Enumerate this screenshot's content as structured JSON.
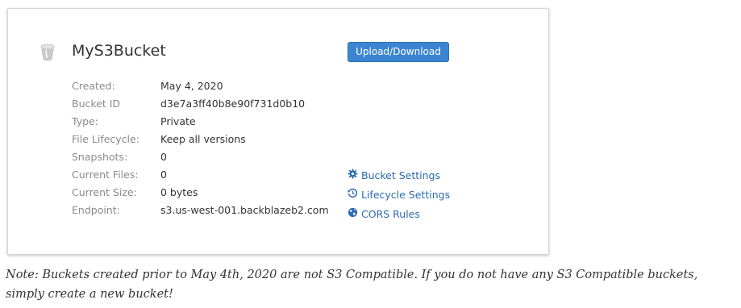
{
  "bucket": {
    "name": "MyS3Bucket",
    "upload_button_label": "Upload/Download"
  },
  "details": [
    {
      "label": "Created:",
      "value": "May 4, 2020"
    },
    {
      "label": "Bucket ID",
      "value": "d3e7a3ff40b8e90f731d0b10"
    },
    {
      "label": "Type:",
      "value": "Private"
    },
    {
      "label": "File Lifecycle:",
      "value": "Keep all versions"
    },
    {
      "label": "Snapshots:",
      "value": "0"
    },
    {
      "label": "Current Files:",
      "value": "0"
    },
    {
      "label": "Current Size:",
      "value": "0 bytes"
    },
    {
      "label": "Endpoint:",
      "value": "s3.us-west-001.backblazeb2.com"
    }
  ],
  "links": {
    "bucket_settings": {
      "label": "Bucket Settings",
      "icon": "gear-icon"
    },
    "lifecycle_settings": {
      "label": "Lifecycle Settings",
      "icon": "history-icon"
    },
    "cors_rules": {
      "label": "CORS Rules",
      "icon": "globe-icon"
    }
  },
  "note": "Note: Buckets created prior to May 4th, 2020 are not S3 Compatible. If you do not have any S3 Compatible buckets, simply create a new bucket!",
  "colors": {
    "accent": "#3b85d0",
    "link": "#2b6cb0",
    "label_gray": "#8a8a8a",
    "text": "#333333"
  }
}
